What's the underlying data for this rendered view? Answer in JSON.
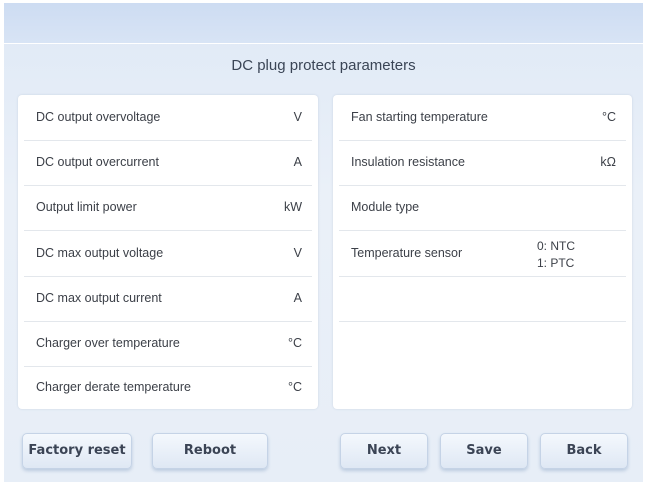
{
  "page": {
    "title": "DC plug protect parameters"
  },
  "left_rows": [
    {
      "label": "DC output overvoltage",
      "unit": "V"
    },
    {
      "label": "DC output overcurrent",
      "unit": "A"
    },
    {
      "label": "Output limit power",
      "unit": "kW"
    },
    {
      "label": "DC max output voltage",
      "unit": "V"
    },
    {
      "label": "DC max output current",
      "unit": "A"
    },
    {
      "label": "Charger over temperature",
      "unit": "°C"
    },
    {
      "label": "Charger derate temperature",
      "unit": "°C"
    }
  ],
  "right_rows": [
    {
      "label": "Fan starting temperature",
      "unit": "°C"
    },
    {
      "label": "Insulation resistance",
      "unit": "kΩ"
    },
    {
      "label": "Module type",
      "unit": ""
    },
    {
      "label": "Temperature sensor",
      "option_1": "0: NTC",
      "option_2": "1: PTC"
    }
  ],
  "buttons": {
    "factory_reset": "Factory reset",
    "reboot": "Reboot",
    "next": "Next",
    "save": "Save",
    "back": "Back"
  }
}
